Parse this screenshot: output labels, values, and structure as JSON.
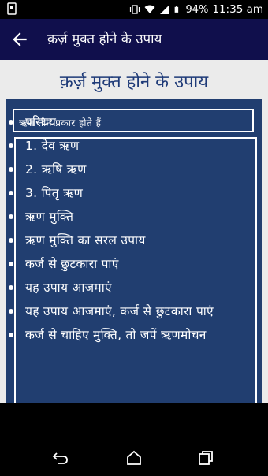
{
  "status_bar": {
    "battery_percent": "94%",
    "time": "11:35 am",
    "icons": [
      "notification-icon",
      "vibrate-icon",
      "wifi-icon",
      "signal-icon",
      "battery-icon"
    ]
  },
  "app_bar": {
    "title": "क़र्ज़ मुक्त होने के उपाय",
    "back_icon": "arrow-left-icon",
    "background": "#100f4c"
  },
  "page": {
    "heading": "क़र्ज़ मुक्त होने के उपाय",
    "heading_color": "#1e3a78",
    "panel_color": "#213e70",
    "sub_header": "ऋण तीन प्रकार होते हैं",
    "items": [
      "परिचय",
      "1. देव ऋण",
      "2. ऋषि ऋण",
      "3. पितृ ऋण",
      "ऋण मुक्ति",
      "ऋण मुक्ति का सरल उपाय",
      "कर्ज से छुटकारा पाएं",
      "यह उपाय आजमाएं",
      "यह उपाय आजमाएं, कर्ज से छुटकारा पाएं",
      "कर्ज से चाहिए मुक्ति, तो जपें ऋणमोचन"
    ]
  },
  "nav_bar": {
    "icons": [
      "back-nav-icon",
      "home-icon",
      "recents-icon"
    ]
  }
}
